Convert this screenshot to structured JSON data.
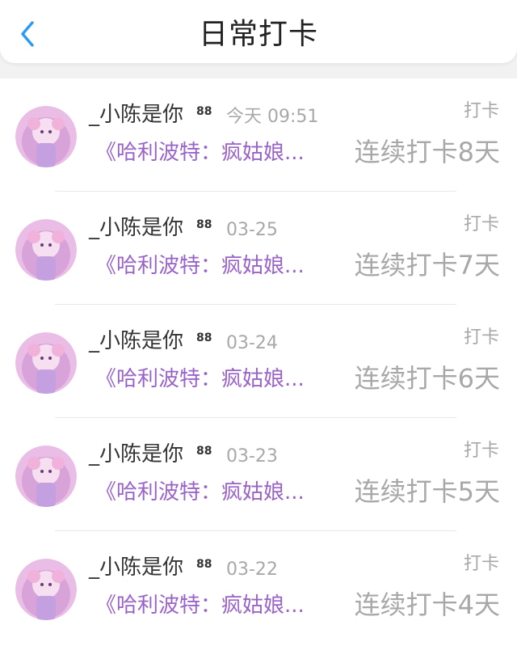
{
  "header": {
    "title": "日常打卡",
    "back_icon": "chevron-left-icon",
    "accent_color": "#2b9af3"
  },
  "checkins": [
    {
      "username": "_小陈是你",
      "badge": "88",
      "time": "今天 09:51",
      "action_label": "打卡",
      "book": "《哈利波特：疯姑娘...",
      "streak": "连续打卡8天"
    },
    {
      "username": "_小陈是你",
      "badge": "88",
      "time": "03-25",
      "action_label": "打卡",
      "book": "《哈利波特：疯姑娘...",
      "streak": "连续打卡7天"
    },
    {
      "username": "_小陈是你",
      "badge": "88",
      "time": "03-24",
      "action_label": "打卡",
      "book": "《哈利波特：疯姑娘...",
      "streak": "连续打卡6天"
    },
    {
      "username": "_小陈是你",
      "badge": "88",
      "time": "03-23",
      "action_label": "打卡",
      "book": "《哈利波特：疯姑娘...",
      "streak": "连续打卡5天"
    },
    {
      "username": "_小陈是你",
      "badge": "88",
      "time": "03-22",
      "action_label": "打卡",
      "book": "《哈利波特：疯姑娘...",
      "streak": "连续打卡4天"
    }
  ],
  "colors": {
    "book_title": "#9a63c9",
    "muted_text": "#a8a8a8",
    "avatar_bg": "#e9bde6"
  }
}
